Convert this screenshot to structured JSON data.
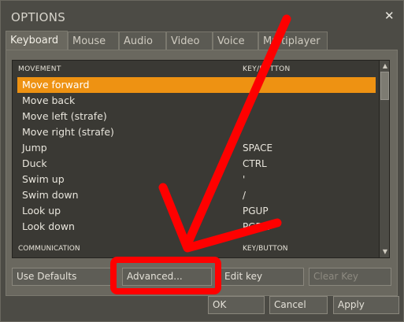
{
  "window": {
    "title": "OPTIONS",
    "close_glyph": "✕"
  },
  "tabs": [
    {
      "label": "Keyboard",
      "active": true
    },
    {
      "label": "Mouse"
    },
    {
      "label": "Audio"
    },
    {
      "label": "Video"
    },
    {
      "label": "Voice"
    },
    {
      "label": "Multiplayer"
    }
  ],
  "list": {
    "header_left": "MOVEMENT",
    "header_right": "KEY/BUTTON",
    "rows": [
      {
        "action": "Move forward",
        "key": "",
        "selected": true
      },
      {
        "action": "Move back",
        "key": ""
      },
      {
        "action": "Move left (strafe)",
        "key": ""
      },
      {
        "action": "Move right (strafe)",
        "key": ""
      },
      {
        "action": "Jump",
        "key": "SPACE"
      },
      {
        "action": "Duck",
        "key": "CTRL"
      },
      {
        "action": "Swim up",
        "key": "'"
      },
      {
        "action": "Swim down",
        "key": "/"
      },
      {
        "action": "Look up",
        "key": "PGUP"
      },
      {
        "action": "Look down",
        "key": "PGDN"
      }
    ],
    "footer_left": "COMMUNICATION",
    "footer_right": "KEY/BUTTON"
  },
  "buttons": {
    "use_defaults": "Use Defaults",
    "advanced": "Advanced...",
    "edit_key": "Edit key",
    "clear_key": "Clear Key",
    "ok": "OK",
    "cancel": "Cancel",
    "apply": "Apply"
  },
  "colors": {
    "selection": "#ee9212",
    "annotation": "#ff0000"
  }
}
